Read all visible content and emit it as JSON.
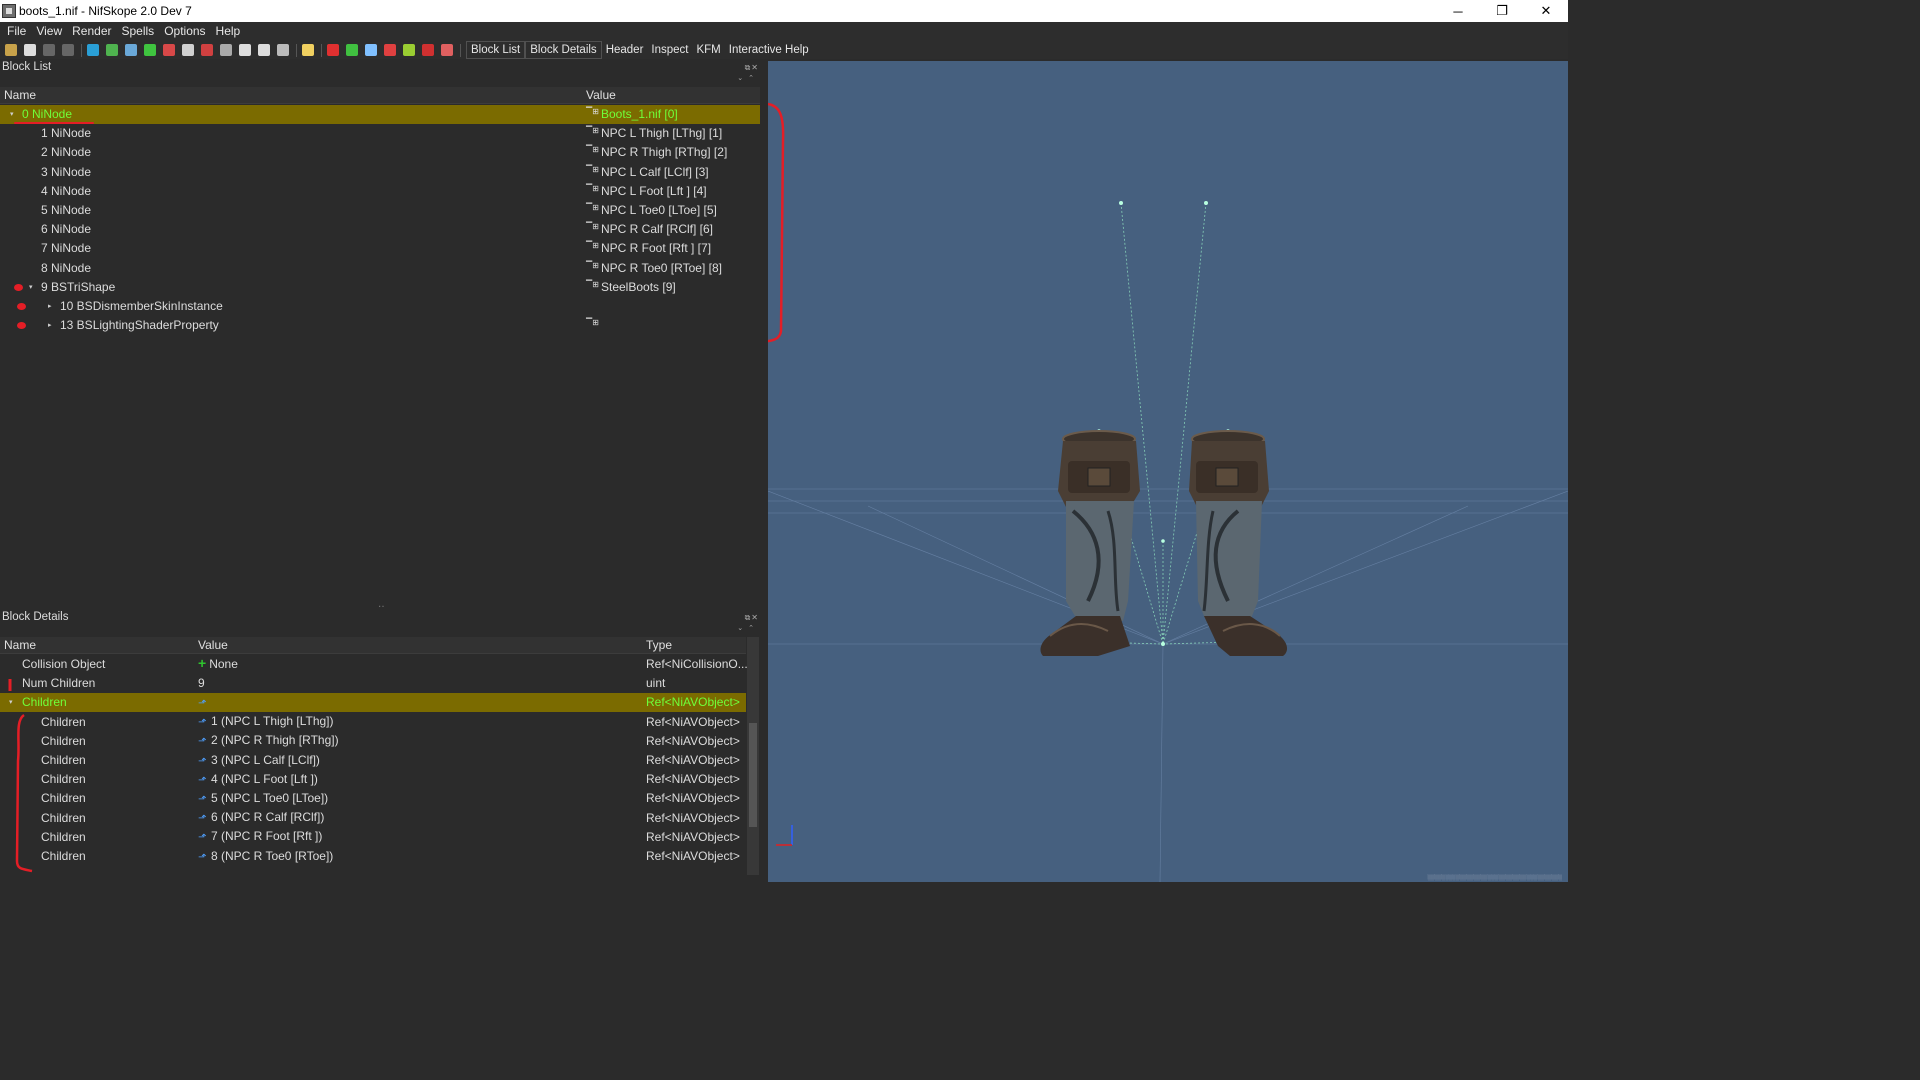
{
  "window": {
    "title": "boots_1.nif - NifSkope 2.0 Dev 7",
    "minimize_glyph": "─",
    "restore_glyph": "❐",
    "close_glyph": "✕"
  },
  "menu": [
    "File",
    "View",
    "Render",
    "Spells",
    "Options",
    "Help"
  ],
  "toolbar": {
    "icons": [
      {
        "name": "open-icon",
        "color": "#c8a24a"
      },
      {
        "name": "save-icon",
        "color": "#dddddd"
      },
      {
        "name": "undo-icon",
        "color": "#666666"
      },
      {
        "name": "redo-icon",
        "color": "#666666"
      },
      {
        "name": "load-icon",
        "color": "#2a9fd6"
      },
      {
        "name": "merge-icon",
        "color": "#4fb34f"
      },
      {
        "name": "view-front-icon",
        "color": "#6aa8d8"
      },
      {
        "name": "view-side-icon",
        "color": "#3fc43f"
      },
      {
        "name": "view-top-icon",
        "color": "#d84848"
      },
      {
        "name": "select-icon",
        "color": "#d0d0d0"
      },
      {
        "name": "cube-icon",
        "color": "#d04040"
      },
      {
        "name": "nodes-icon",
        "color": "#aaaaaa"
      },
      {
        "name": "eye-icon",
        "color": "#dddddd"
      },
      {
        "name": "eye-hidden-icon",
        "color": "#dddddd"
      },
      {
        "name": "texture-icon",
        "color": "#bbbbbb"
      },
      {
        "name": "light-bulb-icon",
        "color": "#f0d060"
      },
      {
        "name": "axes-icon",
        "color": "#e03030"
      },
      {
        "name": "vertex-icon",
        "color": "#40c040"
      },
      {
        "name": "normals-icon",
        "color": "#80c0ff"
      },
      {
        "name": "constraint-icon",
        "color": "#e04040"
      },
      {
        "name": "sphere-icon",
        "color": "#9acd32"
      },
      {
        "name": "marker-icon",
        "color": "#d03030"
      },
      {
        "name": "eraser-icon",
        "color": "#e06060"
      }
    ],
    "text_buttons": [
      "Block List",
      "Block Details",
      "Header",
      "Inspect",
      "KFM",
      "Interactive Help"
    ]
  },
  "block_list": {
    "title": "Block List",
    "columns": [
      "Name",
      "Value"
    ],
    "rows": [
      {
        "name": "0 NiNode",
        "value": "Boots_1.nif [0]",
        "indent": 0,
        "expanded": true,
        "selected": true,
        "has_ref_icon": true
      },
      {
        "name": "1 NiNode",
        "value": "NPC L Thigh [LThg] [1]",
        "indent": 1,
        "has_ref_icon": true
      },
      {
        "name": "2 NiNode",
        "value": "NPC R Thigh [RThg] [2]",
        "indent": 1,
        "has_ref_icon": true
      },
      {
        "name": "3 NiNode",
        "value": "NPC L Calf [LClf] [3]",
        "indent": 1,
        "has_ref_icon": true
      },
      {
        "name": "4 NiNode",
        "value": "NPC L Foot [Lft ] [4]",
        "indent": 1,
        "has_ref_icon": true
      },
      {
        "name": "5 NiNode",
        "value": "NPC L Toe0 [LToe] [5]",
        "indent": 1,
        "has_ref_icon": true
      },
      {
        "name": "6 NiNode",
        "value": "NPC R Calf [RClf] [6]",
        "indent": 1,
        "has_ref_icon": true
      },
      {
        "name": "7 NiNode",
        "value": "NPC R Foot [Rft ] [7]",
        "indent": 1,
        "has_ref_icon": true
      },
      {
        "name": "8 NiNode",
        "value": "NPC R Toe0 [RToe] [8]",
        "indent": 1,
        "has_ref_icon": true
      },
      {
        "name": "9 BSTriShape",
        "value": "SteelBoots [9]",
        "indent": 1,
        "expanded": true,
        "has_ref_icon": true,
        "marked": true
      },
      {
        "name": "10 BSDismemberSkinInstance",
        "value": "",
        "indent": 2,
        "collapsed": true,
        "marked": true
      },
      {
        "name": "13 BSLightingShaderProperty",
        "value": "",
        "indent": 2,
        "collapsed": true,
        "has_ref_icon": true,
        "marked": true
      }
    ]
  },
  "block_details": {
    "title": "Block Details",
    "columns": [
      "Name",
      "Value",
      "Type"
    ],
    "rows": [
      {
        "name": "Collision Object",
        "value": "None",
        "type": "Ref<NiCollisionO...",
        "indent": 0,
        "plus_icon": true
      },
      {
        "name": "Num Children",
        "value": "9",
        "type": "uint",
        "indent": 0
      },
      {
        "name": "Children",
        "value": "",
        "type": "Ref<NiAVObject>",
        "indent": 0,
        "expanded": true,
        "selected": true,
        "link_icon": true
      },
      {
        "name": "Children",
        "value": "1 (NPC L Thigh [LThg])",
        "type": "Ref<NiAVObject>",
        "indent": 1,
        "link_icon": true
      },
      {
        "name": "Children",
        "value": "2 (NPC R Thigh [RThg])",
        "type": "Ref<NiAVObject>",
        "indent": 1,
        "link_icon": true
      },
      {
        "name": "Children",
        "value": "3 (NPC L Calf [LClf])",
        "type": "Ref<NiAVObject>",
        "indent": 1,
        "link_icon": true
      },
      {
        "name": "Children",
        "value": "4 (NPC L Foot [Lft ])",
        "type": "Ref<NiAVObject>",
        "indent": 1,
        "link_icon": true
      },
      {
        "name": "Children",
        "value": "5 (NPC L Toe0 [LToe])",
        "type": "Ref<NiAVObject>",
        "indent": 1,
        "link_icon": true
      },
      {
        "name": "Children",
        "value": "6 (NPC R Calf [RClf])",
        "type": "Ref<NiAVObject>",
        "indent": 1,
        "link_icon": true
      },
      {
        "name": "Children",
        "value": "7 (NPC R Foot [Rft ])",
        "type": "Ref<NiAVObject>",
        "indent": 1,
        "link_icon": true
      },
      {
        "name": "Children",
        "value": "8 (NPC R Toe0 [RToe])",
        "type": "Ref<NiAVObject>",
        "indent": 1,
        "link_icon": true
      }
    ]
  },
  "colors": {
    "selected_row_bg": "#7b6b00",
    "selected_text": "#6fff3a",
    "viewport_bg": "#46607f",
    "annotation_red": "#e41e26"
  }
}
